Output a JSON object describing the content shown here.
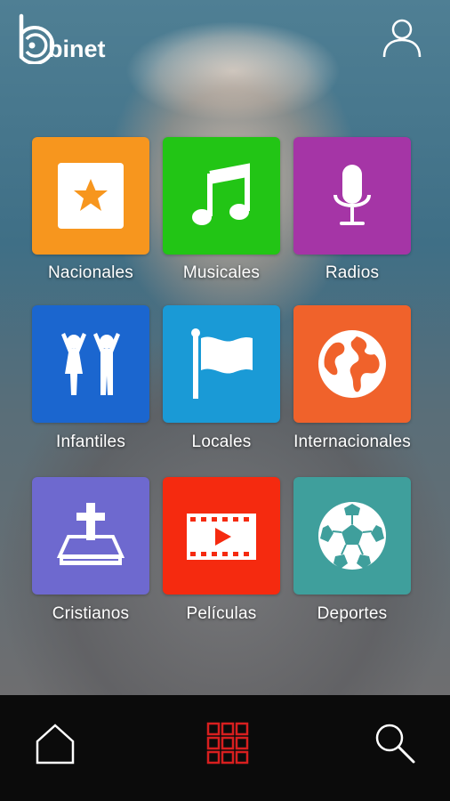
{
  "app": {
    "logo_text": "binet"
  },
  "header": {
    "account_icon": "user-icon"
  },
  "colors": {
    "nacionales": "#f7961e",
    "musicales": "#22c515",
    "radios": "#a535a6",
    "infantiles": "#1b66cf",
    "locales": "#1a9ad6",
    "internacionales": "#f0622b",
    "cristianos": "#6e69cf",
    "peliculas": "#f52a0f",
    "deportes": "#3f9f9c",
    "nav_active": "#d81f1f"
  },
  "categories": [
    {
      "label": "Nacionales",
      "icon": "star-icon"
    },
    {
      "label": "Musicales",
      "icon": "music-note-icon"
    },
    {
      "label": "Radios",
      "icon": "microphone-icon"
    },
    {
      "label": "Infantiles",
      "icon": "children-icon"
    },
    {
      "label": "Locales",
      "icon": "flag-icon"
    },
    {
      "label": "Internacionales",
      "icon": "globe-icon"
    },
    {
      "label": "Cristianos",
      "icon": "bible-cross-icon"
    },
    {
      "label": "Películas",
      "icon": "film-play-icon"
    },
    {
      "label": "Deportes",
      "icon": "soccer-ball-icon"
    }
  ],
  "bottom_nav": [
    {
      "icon": "home-icon",
      "active": false
    },
    {
      "icon": "grid-icon",
      "active": true
    },
    {
      "icon": "search-icon",
      "active": false
    }
  ]
}
